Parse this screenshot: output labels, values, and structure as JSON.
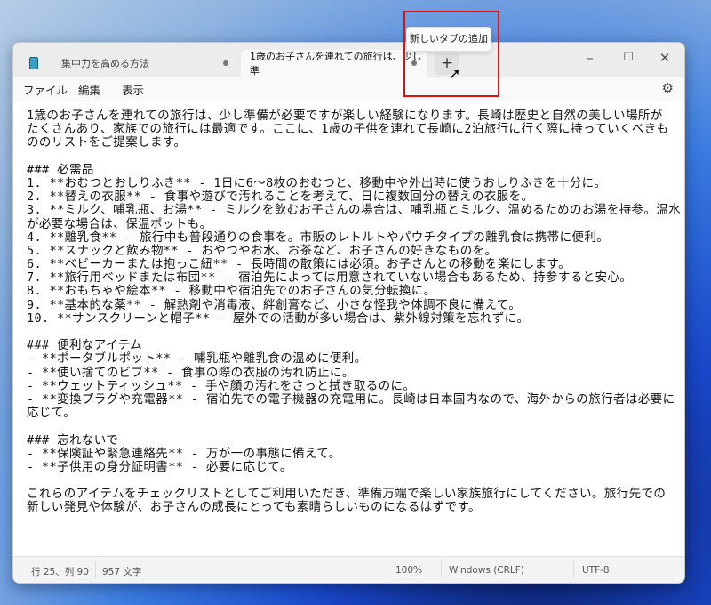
{
  "tabs": [
    {
      "title": "集中力を高める方法",
      "icon": "notepad-icon"
    },
    {
      "title": "1歳のお子さんを連れての旅行は、少し準"
    }
  ],
  "add_tab": {
    "symbol": "+",
    "tooltip": "新しいタブの追加"
  },
  "window_controls": {
    "minimize": "–",
    "maximize": "☐",
    "close": "✕"
  },
  "menu": [
    "ファイル",
    "編集",
    "表示"
  ],
  "settings_icon": "⚙",
  "lines": [
    "1歳のお子さんを連れての旅行は、少し準備が必要ですが楽しい経験になります。長崎は歴史と自然の美しい場所が",
    "たくさんあり、家族での旅行には最適です。ここに、1歳の子供を連れて長崎に2泊旅行に行く際に持っていくべきも",
    "ののリストをご提案します。",
    "",
    "### 必需品",
    "1. **おむつとおしりふき** - 1日に6～8枚のおむつと、移動中や外出時に使うおしりふきを十分に。",
    "2. **替えの衣服** - 食事や遊びで汚れることを考えて、日に複数回分の替えの衣服を。",
    "3. **ミルク、哺乳瓶、お湯** - ミルクを飲むお子さんの場合は、哺乳瓶とミルク、温めるためのお湯を持参。温水",
    "が必要な場合は、保温ポットも。",
    "4. **離乳食** - 旅行中も普段通りの食事を。市販のレトルトやパウチタイプの離乳食は携帯に便利。",
    "5. **スナックと飲み物** - おやつやお水、お茶など、お子さんの好きなものを。",
    "6. **ベビーカーまたは抱っこ紐** - 長時間の散策には必須。お子さんとの移動を楽にします。",
    "7. **旅行用ベッドまたは布団** - 宿泊先によっては用意されていない場合もあるため、持参すると安心。",
    "8. **おもちゃや絵本** - 移動中や宿泊先でのお子さんの気分転換に。",
    "9. **基本的な薬** - 解熱剤や消毒液、絆創膏など、小さな怪我や体調不良に備えて。",
    "10. **サンスクリーンと帽子** - 屋外での活動が多い場合は、紫外線対策を忘れずに。",
    "",
    "### 便利なアイテム",
    "- **ポータブルポット** - 哺乳瓶や離乳食の温めに便利。",
    "- **使い捨てのビブ** - 食事の際の衣服の汚れ防止に。",
    "- **ウェットティッシュ** - 手や顔の汚れをさっと拭き取るのに。",
    "- **変換プラグや充電器** - 宿泊先での電子機器の充電用に。長崎は日本国内なので、海外からの旅行者は必要に",
    "応じて。",
    "",
    "### 忘れないで",
    "- **保険証や緊急連絡先** - 万が一の事態に備えて。",
    "- **子供用の身分証明書** - 必要に応じて。",
    "",
    "これらのアイテムをチェックリストとしてご利用いただき、準備万端で楽しい家族旅行にしてください。旅行先での",
    "新しい発見や体験が、お子さんの成長にとっても素晴らしいものになるはずです。"
  ],
  "status": {
    "position": "行 25、列 90",
    "chars": "957 文字",
    "zoom": "100%",
    "line_ending": "Windows (CRLF)",
    "encoding": "UTF-8"
  },
  "colors": {
    "highlight": "#e01010"
  }
}
